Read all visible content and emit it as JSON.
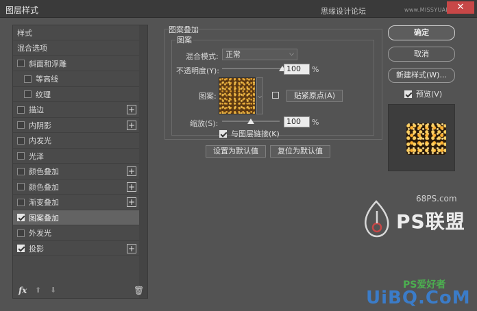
{
  "window": {
    "title": "图层样式",
    "watermark": "思缘设计论坛",
    "watermark_url": "www.MISSYUAN.COM",
    "close_glyph": "✕"
  },
  "sidebar": {
    "items": [
      {
        "label": "样式",
        "checkbox": false,
        "checked": false,
        "plus": false
      },
      {
        "label": "混合选项",
        "checkbox": false,
        "checked": false,
        "plus": false
      },
      {
        "label": "斜面和浮雕",
        "checkbox": true,
        "checked": false,
        "plus": false
      },
      {
        "label": "等高线",
        "checkbox": true,
        "checked": false,
        "plus": false,
        "indent": true
      },
      {
        "label": "纹理",
        "checkbox": true,
        "checked": false,
        "plus": false,
        "indent": true
      },
      {
        "label": "描边",
        "checkbox": true,
        "checked": false,
        "plus": true
      },
      {
        "label": "内阴影",
        "checkbox": true,
        "checked": false,
        "plus": true
      },
      {
        "label": "内发光",
        "checkbox": true,
        "checked": false,
        "plus": false
      },
      {
        "label": "光泽",
        "checkbox": true,
        "checked": false,
        "plus": false
      },
      {
        "label": "颜色叠加",
        "checkbox": true,
        "checked": false,
        "plus": true
      },
      {
        "label": "颜色叠加",
        "checkbox": true,
        "checked": false,
        "plus": true
      },
      {
        "label": "渐变叠加",
        "checkbox": true,
        "checked": false,
        "plus": true
      },
      {
        "label": "图案叠加",
        "checkbox": true,
        "checked": true,
        "plus": false,
        "selected": true
      },
      {
        "label": "外发光",
        "checkbox": true,
        "checked": false,
        "plus": false
      },
      {
        "label": "投影",
        "checkbox": true,
        "checked": true,
        "plus": true
      }
    ],
    "bottom": {
      "fx": "fx",
      "up": "⬆",
      "down": "⬇",
      "trash": "🗑"
    }
  },
  "panel": {
    "section_title": "图案叠加",
    "group_title": "图案",
    "blend_mode_label": "混合模式:",
    "blend_mode_value": "正常",
    "opacity_label": "不透明度(Y):",
    "opacity_value": "100",
    "opacity_fraction": 1.0,
    "pattern_label": "图案:",
    "snap_origin_button": "贴紧原点(A)",
    "scale_label": "缩放(S):",
    "scale_value": "100",
    "scale_fraction": 0.5,
    "link_label": "与图层链接(K)",
    "link_checked": true,
    "percent": "%",
    "set_default_button": "设置为默认值",
    "reset_default_button": "复位为默认值"
  },
  "right": {
    "ok_button": "确定",
    "cancel_button": "取消",
    "new_style_button": "新建样式(W)...",
    "preview_label": "预览(V)",
    "preview_checked": true
  },
  "watermarks": {
    "site": "68PS.com",
    "brand": "PS联盟",
    "bottom": "UiBQ.CoM",
    "bottom2": "PS爱好者"
  },
  "colors": {
    "background": "#535353",
    "titlebar": "#3a3a3a",
    "close": "#c74747",
    "selected_row": "#636363",
    "accent_blue": "#3b7cc8"
  }
}
